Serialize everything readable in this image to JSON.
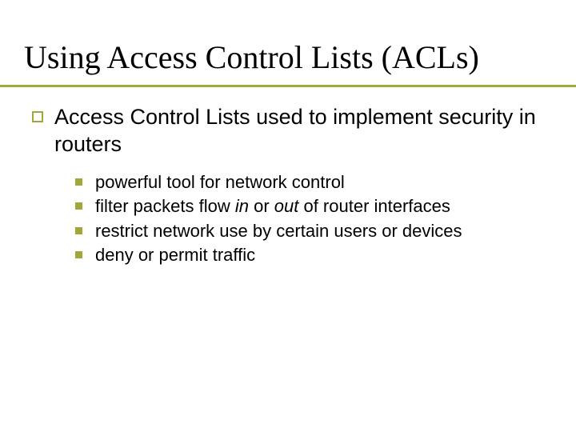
{
  "title": "Using Access Control Lists (ACLs)",
  "main_point": "Access Control Lists used to implement security in routers",
  "sub_points": {
    "a": "powerful tool for network control",
    "b_pre": "filter packets flow ",
    "b_in": "in",
    "b_mid": " or ",
    "b_out": "out",
    "b_post": " of router interfaces",
    "c": "restrict network use by certain users or devices",
    "d": "deny or permit traffic"
  },
  "colors": {
    "accent": "#a2a73a"
  }
}
